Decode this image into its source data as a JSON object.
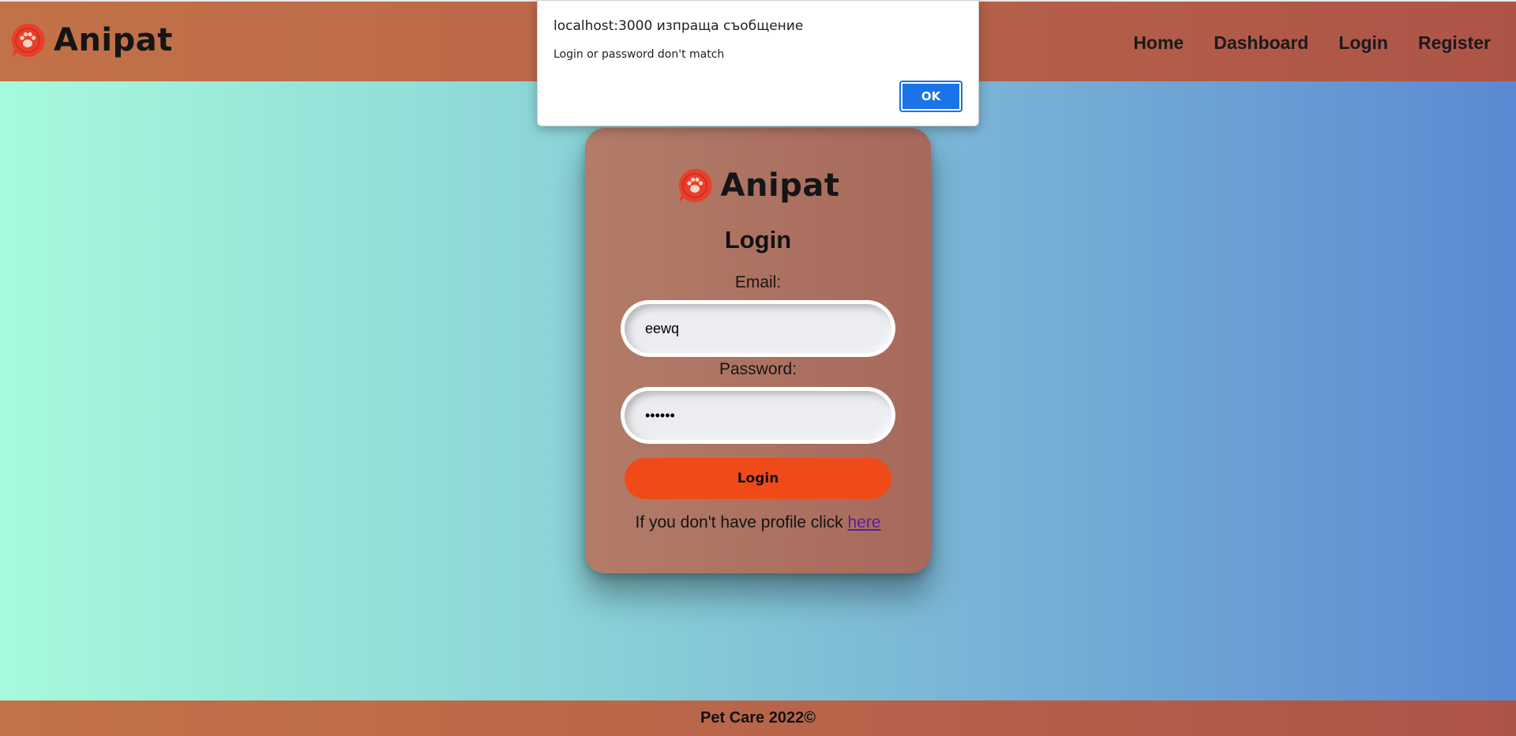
{
  "header": {
    "brand_name": "Anipat",
    "nav": {
      "home": "Home",
      "dashboard": "Dashboard",
      "login": "Login",
      "register": "Register"
    }
  },
  "card": {
    "brand_name": "Anipat",
    "title": "Login",
    "email_label": "Email:",
    "email_value": "eewq",
    "password_label": "Password:",
    "password_value": "••••••",
    "login_button": "Login",
    "register_hint": "If you don't have profile click",
    "register_link": "here"
  },
  "footer": {
    "text": "Pet Care 2022©"
  },
  "dialog": {
    "origin": "localhost:3000 изпраща съобщение",
    "message": "Login or password don't match",
    "ok_label": "OK"
  },
  "colors": {
    "accent_orange": "#f14a19",
    "logo_red": "#ea3e2b",
    "dialog_blue": "#1a73e8"
  },
  "icons": {
    "logo": "paw-chat-bubble-icon"
  }
}
